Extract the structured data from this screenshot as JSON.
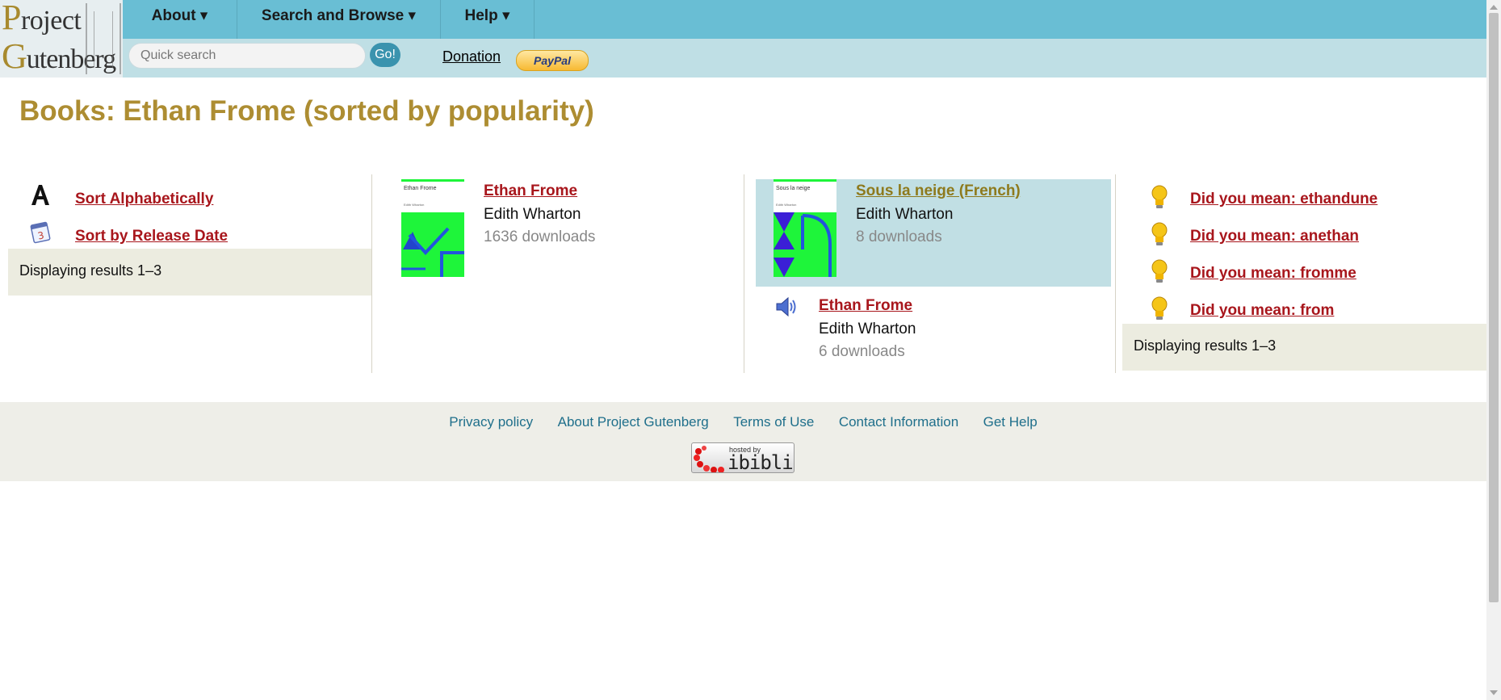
{
  "logo": {
    "line1_cap": "P",
    "line1_rest": "roject",
    "line2_cap": "G",
    "line2_rest": "utenberg"
  },
  "nav": {
    "about": "About ▾",
    "search_browse": "Search and Browse ▾",
    "help": "Help ▾"
  },
  "search": {
    "placeholder": "Quick search",
    "go_label": "Go!"
  },
  "donation": {
    "label": "Donation",
    "paypal_label": "PayPal"
  },
  "page_title": "Books: Ethan Frome (sorted by popularity)",
  "sort_options": [
    {
      "label": "Sort Alphabetically",
      "icon": "letter-a-icon"
    },
    {
      "label": "Sort by Release Date",
      "icon": "calendar-icon"
    }
  ],
  "results_text": "Displaying results 1–3",
  "books": [
    {
      "title": "Ethan Frome",
      "author": "Edith Wharton",
      "downloads": "1636 downloads",
      "cover_title": "Ethan Frome",
      "cover_author": "Edith Wharton",
      "type": "text",
      "highlighted": false
    },
    {
      "title": "Sous la neige (French)",
      "author": "Edith Wharton",
      "downloads": "8 downloads",
      "cover_title": "Sous la neige",
      "cover_author": "Edith Wharton",
      "type": "text",
      "highlighted": true
    },
    {
      "title": "Ethan Frome",
      "author": "Edith Wharton",
      "downloads": "6 downloads",
      "type": "audio",
      "highlighted": false
    }
  ],
  "suggestions": [
    "Did you mean: ethandune",
    "Did you mean: anethan",
    "Did you mean: fromme",
    "Did you mean: from"
  ],
  "footer": {
    "links": [
      "Privacy policy",
      "About Project Gutenberg",
      "Terms of Use",
      "Contact Information",
      "Get Help"
    ],
    "badge_small": "hosted by",
    "badge_big": "ibiblio"
  },
  "colors": {
    "topbar": "#69bed4",
    "subbar": "#bfdfe5",
    "title": "#ad8d32",
    "link": "#a8161c",
    "highlight": "#c1dfe4",
    "results_bg": "#ecece0",
    "footer_bg": "#eeeee8",
    "footer_link": "#1f6f8b"
  }
}
